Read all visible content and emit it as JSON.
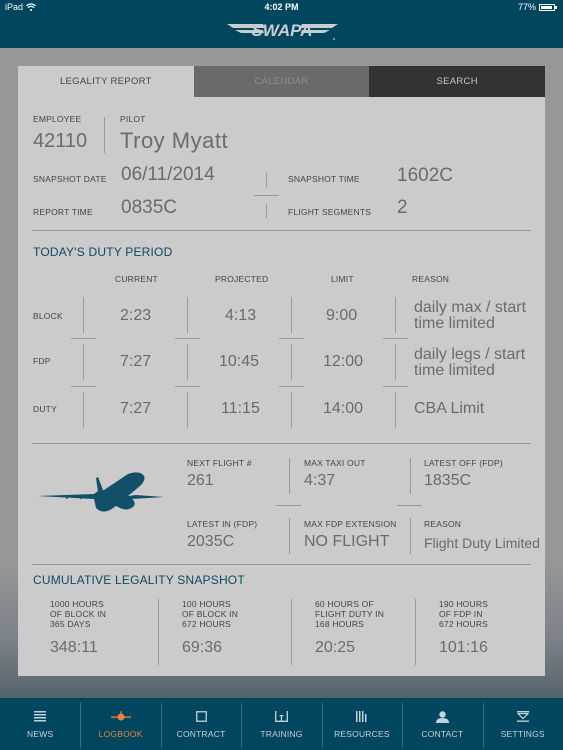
{
  "status_bar": {
    "device": "iPad",
    "time": "4:02 PM",
    "battery": "77%",
    "battery_level": 0.77
  },
  "header": {
    "logo_text": "SWAPA"
  },
  "tabs": [
    {
      "label": "LEGALITY REPORT",
      "active": true
    },
    {
      "label": "CALENDAR",
      "active": false
    },
    {
      "label": "SEARCH",
      "active": false
    }
  ],
  "employee": {
    "employee_label": "EMPLOYEE",
    "employee_value": "42110",
    "pilot_label": "PILOT",
    "pilot_value": "Troy Myatt"
  },
  "snapshot": {
    "snapshot_date_label": "SNAPSHOT DATE",
    "snapshot_date": "06/11/2014",
    "snapshot_time_label": "SNAPSHOT TIME",
    "snapshot_time": "1602C",
    "report_time_label": "REPORT TIME",
    "report_time": "0835C",
    "flight_segments_label": "FLIGHT SEGMENTS",
    "flight_segments": "2"
  },
  "duty_period": {
    "title": "TODAY'S DUTY PERIOD",
    "columns": [
      "CURRENT",
      "PROJECTED",
      "LIMIT",
      "REASON"
    ],
    "rows": [
      {
        "label": "BLOCK",
        "current": "2:23",
        "projected": "4:13",
        "limit": "9:00",
        "reason_line1": "daily max / start",
        "reason_line2": "time limited"
      },
      {
        "label": "FDP",
        "current": "7:27",
        "projected": "10:45",
        "limit": "12:00",
        "reason_line1": "daily legs / start",
        "reason_line2": "time limited"
      },
      {
        "label": "DUTY",
        "current": "7:27",
        "projected": "11:15",
        "limit": "14:00",
        "reason_line1": "CBA Limit",
        "reason_line2": ""
      }
    ]
  },
  "next_flight": {
    "next_flight_label": "NEXT FLIGHT #",
    "next_flight": "261",
    "max_taxi_out_label": "MAX TAXI OUT",
    "max_taxi_out": "4:37",
    "latest_off_label": "LATEST OFF (FDP)",
    "latest_off": "1835C",
    "latest_in_label": "LATEST IN (FDP)",
    "latest_in": "2035C",
    "max_fdp_ext_label": "MAX FDP EXTENSION",
    "max_fdp_ext": "NO FLIGHT",
    "reason_label": "REASON",
    "reason": "Flight Duty Limited"
  },
  "cumulative": {
    "title": "CUMULATIVE LEGALITY SNAPSHOT",
    "items": [
      {
        "line1": "1000 HOURS",
        "line2": "OF BLOCK IN",
        "line3": "365 DAYS",
        "value": "348:11"
      },
      {
        "line1": "100 HOURS",
        "line2": "OF BLOCK IN",
        "line3": "672 HOURS",
        "value": "69:36"
      },
      {
        "line1": "60 HOURS OF",
        "line2": "FLIGHT DUTY IN",
        "line3": "168 HOURS",
        "value": "20:25"
      },
      {
        "line1": "190 HOURS",
        "line2": "OF FDP IN",
        "line3": "672 HOURS",
        "value": "101:16"
      }
    ]
  },
  "nav": [
    {
      "label": "NEWS",
      "icon": "news-icon",
      "active": false
    },
    {
      "label": "LOGBOOK",
      "icon": "logbook-icon",
      "active": true
    },
    {
      "label": "CONTRACT",
      "icon": "contract-icon",
      "active": false
    },
    {
      "label": "TRAINING",
      "icon": "training-icon",
      "active": false
    },
    {
      "label": "RESOURCES",
      "icon": "resources-icon",
      "active": false
    },
    {
      "label": "CONTACT",
      "icon": "contact-icon",
      "active": false
    },
    {
      "label": "SETTINGS",
      "icon": "settings-icon",
      "active": false
    }
  ],
  "colors": {
    "brand": "#00465f",
    "accent": "#e8833a",
    "section_title": "#0d4a63"
  }
}
